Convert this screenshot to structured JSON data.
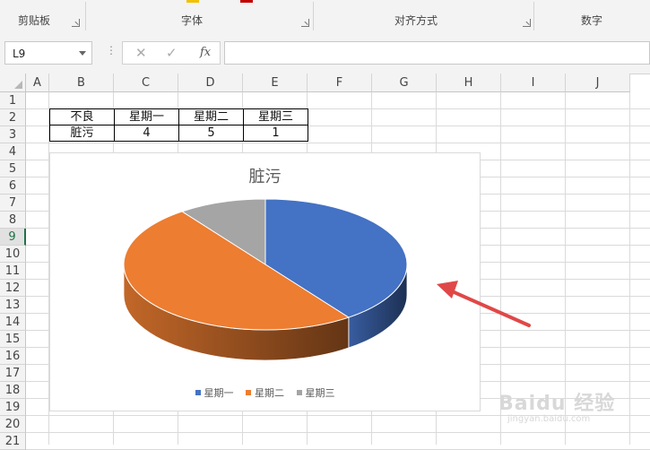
{
  "ribbon": {
    "groups": [
      {
        "label": "剪贴板"
      },
      {
        "label": "字体"
      },
      {
        "label": "对齐方式"
      },
      {
        "label": "数字"
      }
    ]
  },
  "formula_bar": {
    "name_box": "L9",
    "cancel_icon": "close-icon",
    "confirm_icon": "check-icon",
    "function_label": "fx",
    "formula": ""
  },
  "sheet": {
    "columns": [
      "A",
      "B",
      "C",
      "D",
      "E",
      "F",
      "G",
      "H",
      "I",
      "J"
    ],
    "rows": [
      "1",
      "2",
      "3",
      "4",
      "5",
      "6",
      "7",
      "8",
      "9",
      "10",
      "11",
      "12",
      "13",
      "14",
      "15",
      "16",
      "17",
      "18",
      "19",
      "20",
      "21"
    ],
    "active_row": "9",
    "table": {
      "header": [
        "不良",
        "星期一",
        "星期二",
        "星期三"
      ],
      "row": [
        "脏污",
        "4",
        "5",
        "1"
      ]
    }
  },
  "chart_data": {
    "type": "pie",
    "title": "脏污",
    "categories": [
      "星期一",
      "星期二",
      "星期三"
    ],
    "values": [
      4,
      5,
      1
    ],
    "colors": [
      "#4472C4",
      "#ED7D31",
      "#A5A5A5"
    ],
    "style": "3d",
    "legend_position": "bottom"
  },
  "watermark": {
    "main": "Baidu 经验",
    "sub": "jingyan.baidu.com"
  }
}
